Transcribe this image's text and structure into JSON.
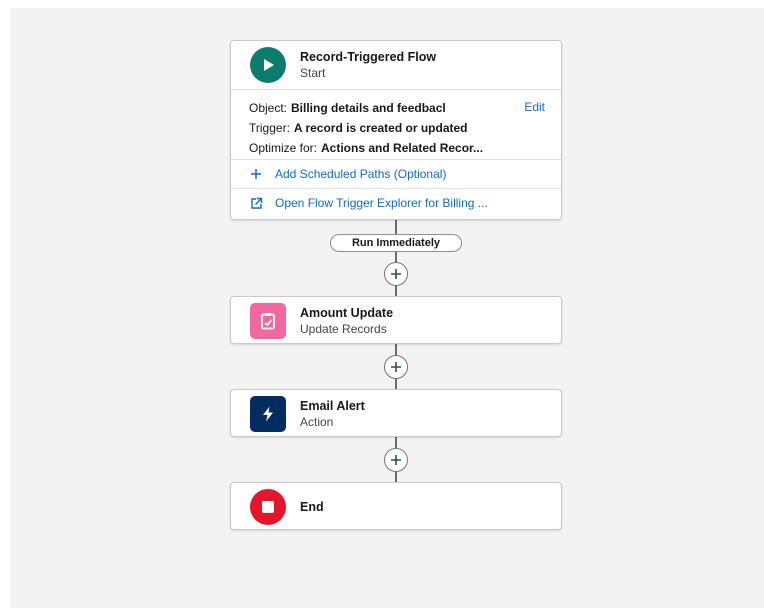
{
  "start": {
    "title": "Record-Triggered Flow",
    "subtitle": "Start",
    "object_key": "Object:",
    "object_value": "Billing details and feedbacl",
    "edit_label": "Edit",
    "trigger_key": "Trigger:",
    "trigger_value": "A record is created or updated",
    "optimize_key": "Optimize for:",
    "optimize_value": "Actions and Related Recor...",
    "scheduled_paths_label": "Add Scheduled Paths (Optional)",
    "explorer_label": "Open Flow Trigger Explorer for Billing ..."
  },
  "path_label": "Run Immediately",
  "nodes": [
    {
      "title": "Amount Update",
      "subtitle": "Update Records",
      "icon": "update-records-icon",
      "color": "#f2679e"
    },
    {
      "title": "Email Alert",
      "subtitle": "Action",
      "icon": "action-lightning-icon",
      "color": "#032d60"
    }
  ],
  "end": {
    "title": "End",
    "icon": "stop-icon",
    "color": "#e3162b"
  },
  "colors": {
    "start_icon": "#0e7c6c",
    "link": "#0b6bcb",
    "canvas": "#f3f3f3"
  }
}
